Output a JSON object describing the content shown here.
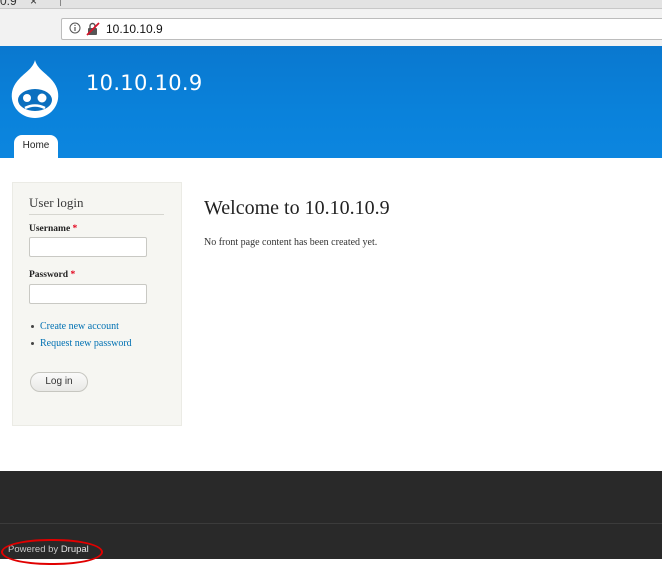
{
  "browser": {
    "tab_fragment": "0.9",
    "tab_close": "×",
    "url": "10.10.10.9"
  },
  "header": {
    "site_name": "10.10.10.9",
    "nav": [
      {
        "label": "Home"
      }
    ]
  },
  "sidebar": {
    "title": "User login",
    "username_label": "Username",
    "password_label": "Password",
    "required_marker": "*",
    "links": [
      {
        "label": "Create new account"
      },
      {
        "label": "Request new password"
      }
    ],
    "login_button": "Log in"
  },
  "main": {
    "title": "Welcome to 10.10.10.9",
    "text": "No front page content has been created yet."
  },
  "footer": {
    "powered_prefix": "Powered by ",
    "powered_link": "Drupal"
  },
  "colors": {
    "header_blue": "#0a7fd8",
    "link_blue": "#0071b3",
    "footer_bg": "#292929",
    "annotation_red": "#e00000"
  }
}
